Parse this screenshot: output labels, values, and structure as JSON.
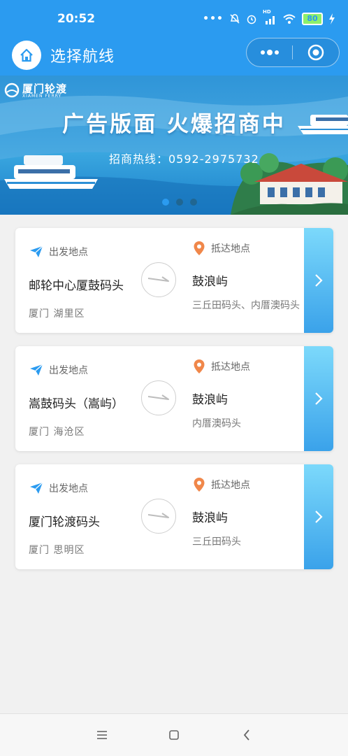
{
  "status_bar": {
    "time": "20:52",
    "battery": "80",
    "network_label": "HD"
  },
  "nav": {
    "title": "选择航线"
  },
  "banner": {
    "logo_cn": "厦门轮渡",
    "logo_en": "XIAMEN FERRY",
    "headline": "广告版面  火爆招商中",
    "hotline": "招商热线：0592-2975732",
    "slide_count": 3,
    "active_slide": 1
  },
  "labels": {
    "departure": "出发地点",
    "arrival": "抵达地点"
  },
  "routes": [
    {
      "from_name": "邮轮中心厦鼓码头",
      "from_region": "厦门 湖里区",
      "to_name": "鼓浪屿",
      "to_pier": "三丘田码头、内厝澳码头"
    },
    {
      "from_name": "嵩鼓码头（嵩屿）",
      "from_region": "厦门 海沧区",
      "to_name": "鼓浪屿",
      "to_pier": "内厝澳码头"
    },
    {
      "from_name": "厦门轮渡码头",
      "from_region": "厦门 思明区",
      "to_name": "鼓浪屿",
      "to_pier": "三丘田码头"
    }
  ],
  "colors": {
    "primary": "#2b9bf0",
    "departure_icon": "#2b9bf0",
    "arrival_icon": "#f0874a",
    "go_button_top": "#7cd9fb",
    "go_button_bottom": "#3aa2ea"
  }
}
